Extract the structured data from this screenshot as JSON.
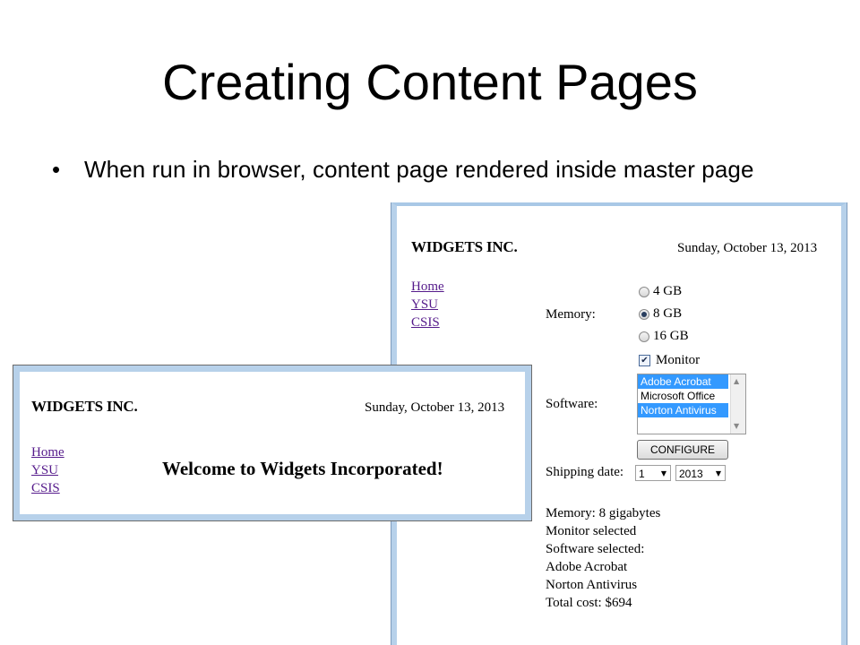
{
  "slide": {
    "title": "Creating Content Pages",
    "bullet_marker": "•",
    "bullet": "When run in browser, content page rendered inside master page"
  },
  "right_shot": {
    "brand": "WIDGETS INC.",
    "date": "Sunday, October 13, 2013",
    "nav": [
      "Home",
      "YSU",
      "CSIS"
    ],
    "memory_label": "Memory:",
    "memory_options": [
      {
        "label": "4 GB",
        "checked": false
      },
      {
        "label": "8 GB",
        "checked": true
      },
      {
        "label": "16 GB",
        "checked": false
      }
    ],
    "monitor_label": "Monitor",
    "monitor_checked": true,
    "software_label": "Software:",
    "software_options": [
      {
        "label": "Adobe Acrobat",
        "selected": true
      },
      {
        "label": "Microsoft Office",
        "selected": false
      },
      {
        "label": "Norton Antivirus",
        "selected": true
      }
    ],
    "configure_button": "CONFIGURE",
    "shipping_label": "Shipping date:",
    "shipping_day": "1",
    "shipping_year": "2013",
    "summary": [
      "Memory: 8 gigabytes",
      "Monitor selected",
      "Software selected:",
      "Adobe Acrobat",
      "Norton Antivirus",
      "Total cost: $694"
    ]
  },
  "left_shot": {
    "brand": "WIDGETS INC.",
    "date": "Sunday, October 13, 2013",
    "nav": [
      "Home",
      "YSU",
      "CSIS"
    ],
    "welcome": "Welcome to Widgets Incorporated!"
  },
  "colors": {
    "window_border": "#b7d1ea",
    "link": "#551a8b",
    "selection": "#3399ff"
  },
  "icons": {
    "scroll_up": "▲",
    "scroll_down": "▼",
    "dropdown": "▼",
    "check": "✔"
  }
}
